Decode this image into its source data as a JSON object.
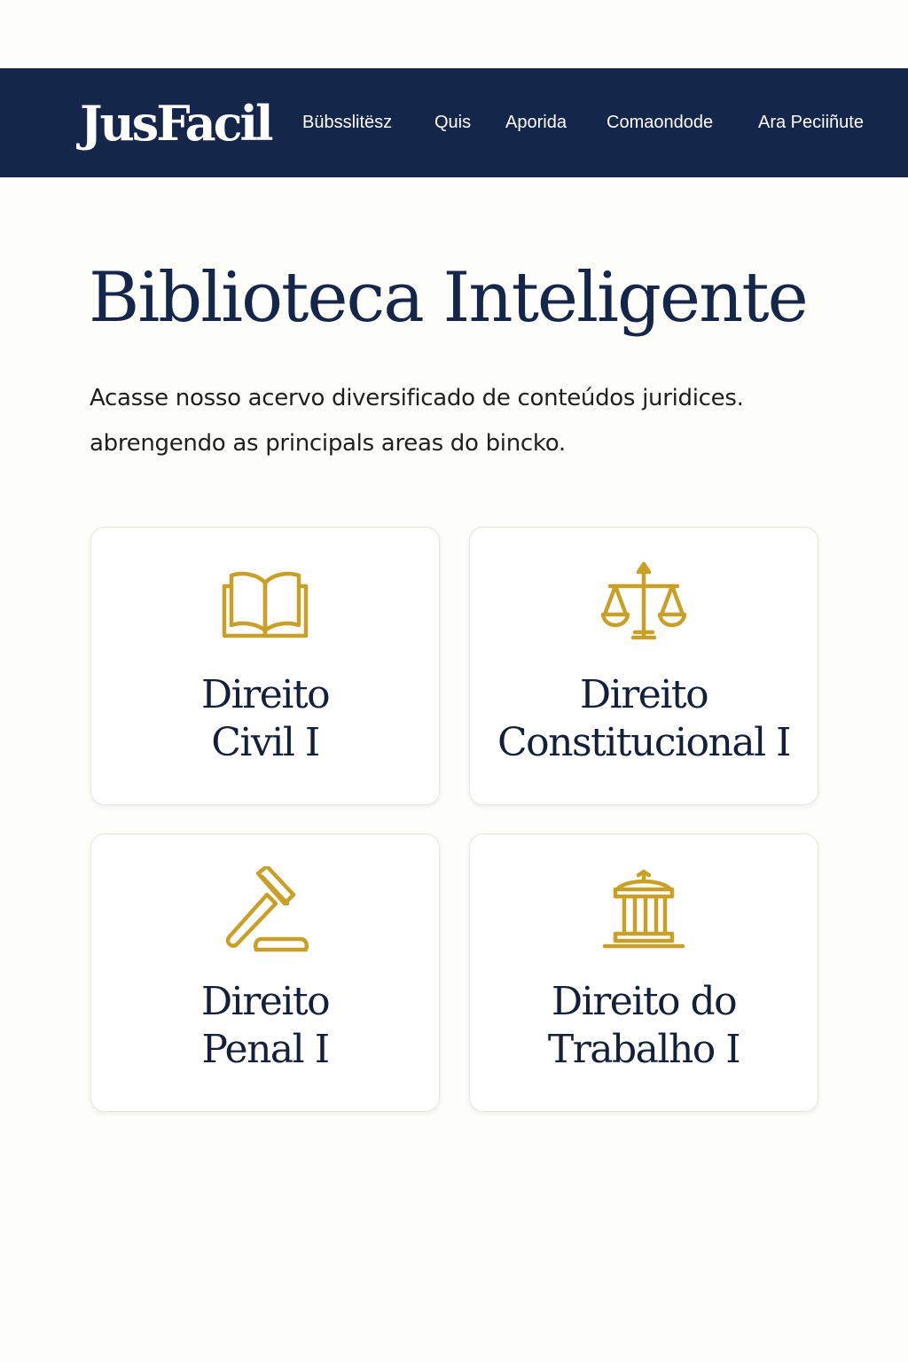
{
  "brand": {
    "logo": "JusFacil",
    "nav_color": "#14264a",
    "accent_color": "#c9a027"
  },
  "nav": {
    "items": [
      {
        "label": "Bübsslitësz"
      },
      {
        "label": "Quis"
      },
      {
        "label": "Aporida"
      },
      {
        "label": "Comaondode"
      },
      {
        "label": "Ara Peciiñute"
      }
    ]
  },
  "hero": {
    "title": "Biblioteca Inteligente",
    "intro_line1": "Acasse nosso acervo diversificado de conteúdos juridices.",
    "intro_line2": "abrengendo as principals areas do bincko."
  },
  "cards": [
    {
      "icon": "open-book-icon",
      "title_line1": "Direito",
      "title_line2": "Civil I"
    },
    {
      "icon": "scales-icon",
      "title_line1": "Direito",
      "title_line2": "Constitucional I"
    },
    {
      "icon": "gavel-icon",
      "title_line1": "Direito",
      "title_line2": "Penal I"
    },
    {
      "icon": "courthouse-icon",
      "title_line1": "Direito do",
      "title_line2": "Trabalho I"
    }
  ]
}
